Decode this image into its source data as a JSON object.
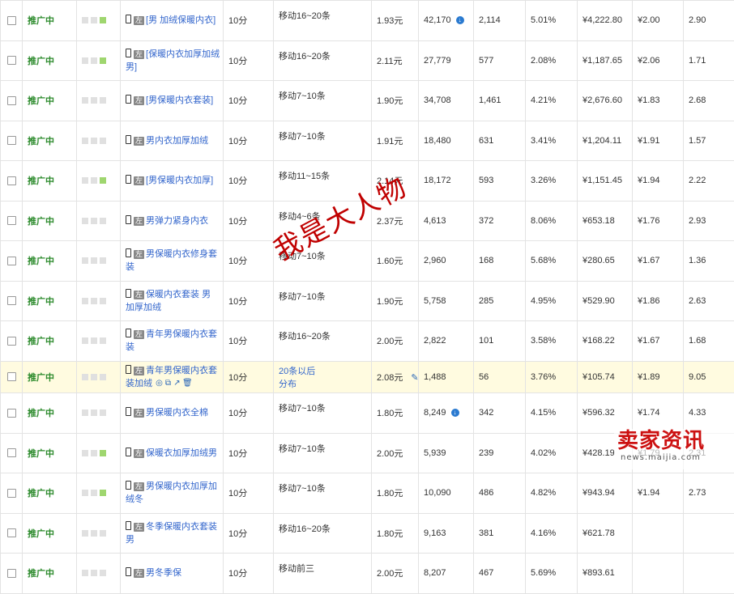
{
  "rows": [
    {
      "status": "推广中",
      "bars": [
        0,
        0,
        1
      ],
      "tag": "左",
      "keyword": "[男 加绒保暖内衣]",
      "actions": false,
      "bid": "10分",
      "match": "移动16~20条",
      "match_link": false,
      "price": "1.93元",
      "pencil": false,
      "impressions": "42,170",
      "imp_icon": true,
      "clicks": "2,114",
      "ctr": "5.01%",
      "cost": "¥4,222.80",
      "cpc": "¥2.00",
      "rank": "2.90",
      "hl": false
    },
    {
      "status": "推广中",
      "bars": [
        0,
        0,
        1
      ],
      "tag": "左",
      "keyword": "[保暖内衣加厚加绒 男]",
      "actions": false,
      "bid": "10分",
      "match": "移动16~20条",
      "match_link": false,
      "price": "2.11元",
      "pencil": false,
      "impressions": "27,779",
      "imp_icon": false,
      "clicks": "577",
      "ctr": "2.08%",
      "cost": "¥1,187.65",
      "cpc": "¥2.06",
      "rank": "1.71",
      "hl": false
    },
    {
      "status": "推广中",
      "bars": [
        0,
        0,
        0
      ],
      "tag": "左",
      "keyword": "[男保暖内衣套装]",
      "actions": false,
      "bid": "10分",
      "match": "移动7~10条",
      "match_link": false,
      "price": "1.90元",
      "pencil": false,
      "impressions": "34,708",
      "imp_icon": false,
      "clicks": "1,461",
      "ctr": "4.21%",
      "cost": "¥2,676.60",
      "cpc": "¥1.83",
      "rank": "2.68",
      "hl": false
    },
    {
      "status": "推广中",
      "bars": [
        0,
        0,
        0
      ],
      "tag": "左",
      "keyword": "男内衣加厚加绒",
      "actions": false,
      "bid": "10分",
      "match": "移动7~10条",
      "match_link": false,
      "price": "1.91元",
      "pencil": false,
      "impressions": "18,480",
      "imp_icon": false,
      "clicks": "631",
      "ctr": "3.41%",
      "cost": "¥1,204.11",
      "cpc": "¥1.91",
      "rank": "1.57",
      "hl": false
    },
    {
      "status": "推广中",
      "bars": [
        0,
        0,
        1
      ],
      "tag": "左",
      "keyword": "[男保暖内衣加厚]",
      "actions": false,
      "bid": "10分",
      "match": "移动11~15条",
      "match_link": false,
      "price": "2.14元",
      "pencil": false,
      "impressions": "18,172",
      "imp_icon": false,
      "clicks": "593",
      "ctr": "3.26%",
      "cost": "¥1,151.45",
      "cpc": "¥1.94",
      "rank": "2.22",
      "hl": false
    },
    {
      "status": "推广中",
      "bars": [
        0,
        0,
        0
      ],
      "tag": "左",
      "keyword": "男弹力紧身内衣",
      "actions": false,
      "bid": "10分",
      "match": "移动4~6条",
      "match_link": false,
      "price": "2.37元",
      "pencil": false,
      "impressions": "4,613",
      "imp_icon": false,
      "clicks": "372",
      "ctr": "8.06%",
      "cost": "¥653.18",
      "cpc": "¥1.76",
      "rank": "2.93",
      "hl": false
    },
    {
      "status": "推广中",
      "bars": [
        0,
        0,
        0
      ],
      "tag": "左",
      "keyword": "男保暖内衣修身套装",
      "actions": false,
      "bid": "10分",
      "match": "移动7~10条",
      "match_link": false,
      "price": "1.60元",
      "pencil": false,
      "impressions": "2,960",
      "imp_icon": false,
      "clicks": "168",
      "ctr": "5.68%",
      "cost": "¥280.65",
      "cpc": "¥1.67",
      "rank": "1.36",
      "hl": false
    },
    {
      "status": "推广中",
      "bars": [
        0,
        0,
        0
      ],
      "tag": "左",
      "keyword": "保暖内衣套装 男 加厚加绒",
      "actions": false,
      "bid": "10分",
      "match": "移动7~10条",
      "match_link": false,
      "price": "1.90元",
      "pencil": false,
      "impressions": "5,758",
      "imp_icon": false,
      "clicks": "285",
      "ctr": "4.95%",
      "cost": "¥529.90",
      "cpc": "¥1.86",
      "rank": "2.63",
      "hl": false
    },
    {
      "status": "推广中",
      "bars": [
        0,
        0,
        0
      ],
      "tag": "左",
      "keyword": "青年男保暖内衣套装",
      "actions": false,
      "bid": "10分",
      "match": "移动16~20条",
      "match_link": false,
      "price": "2.00元",
      "pencil": false,
      "impressions": "2,822",
      "imp_icon": false,
      "clicks": "101",
      "ctr": "3.58%",
      "cost": "¥168.22",
      "cpc": "¥1.67",
      "rank": "1.68",
      "hl": false
    },
    {
      "status": "推广中",
      "bars": [
        0,
        0,
        0
      ],
      "tag": "左",
      "keyword": "青年男保暖内衣套装加绒",
      "actions": true,
      "bid": "10分",
      "match": "20条以后",
      "match2": "分布",
      "match_link": true,
      "price": "2.08元",
      "pencil": true,
      "impressions": "1,488",
      "imp_icon": false,
      "clicks": "56",
      "ctr": "3.76%",
      "cost": "¥105.74",
      "cpc": "¥1.89",
      "rank": "9.05",
      "hl": true
    },
    {
      "status": "推广中",
      "bars": [
        0,
        0,
        0
      ],
      "tag": "左",
      "keyword": "男保暖内衣全棉",
      "actions": false,
      "bid": "10分",
      "match": "移动7~10条",
      "match_link": false,
      "price": "1.80元",
      "pencil": false,
      "impressions": "8,249",
      "imp_icon": true,
      "clicks": "342",
      "ctr": "4.15%",
      "cost": "¥596.32",
      "cpc": "¥1.74",
      "rank": "4.33",
      "hl": false
    },
    {
      "status": "推广中",
      "bars": [
        0,
        0,
        1
      ],
      "tag": "左",
      "keyword": "保暖衣加厚加绒男",
      "actions": false,
      "bid": "10分",
      "match": "移动7~10条",
      "match_link": false,
      "price": "2.00元",
      "pencil": false,
      "impressions": "5,939",
      "imp_icon": false,
      "clicks": "239",
      "ctr": "4.02%",
      "cost": "¥428.19",
      "cpc": "¥1.79",
      "rank": "2.31",
      "hl": false
    },
    {
      "status": "推广中",
      "bars": [
        0,
        0,
        1
      ],
      "tag": "左",
      "keyword": "男保暖内衣加厚加绒冬",
      "actions": false,
      "bid": "10分",
      "match": "移动7~10条",
      "match_link": false,
      "price": "1.80元",
      "pencil": false,
      "impressions": "10,090",
      "imp_icon": false,
      "clicks": "486",
      "ctr": "4.82%",
      "cost": "¥943.94",
      "cpc": "¥1.94",
      "rank": "2.73",
      "hl": false
    },
    {
      "status": "推广中",
      "bars": [
        0,
        0,
        0
      ],
      "tag": "左",
      "keyword": "冬季保暖内衣套装男",
      "actions": false,
      "bid": "10分",
      "match": "移动16~20条",
      "match_link": false,
      "price": "1.80元",
      "pencil": false,
      "impressions": "9,163",
      "imp_icon": false,
      "clicks": "381",
      "ctr": "4.16%",
      "cost": "¥621.78",
      "cpc": "",
      "rank": "",
      "hl": false
    },
    {
      "status": "推广中",
      "bars": [
        0,
        0,
        0
      ],
      "tag": "左",
      "keyword": "男冬季保",
      "actions": false,
      "bid": "10分",
      "match": "移动前三",
      "match_link": false,
      "price": "2.00元",
      "pencil": false,
      "impressions": "8,207",
      "imp_icon": false,
      "clicks": "467",
      "ctr": "5.69%",
      "cost": "¥893.61",
      "cpc": "",
      "rank": "",
      "hl": false
    }
  ],
  "watermark": "我是大人物",
  "logo": {
    "cn": "卖家资讯",
    "url": "news.maijia.com"
  },
  "colors": {
    "status": "#2b8a2b",
    "link": "#3366cc",
    "highlight": "#fffbe0",
    "watermark": "#c00000",
    "logo": "#cc1111"
  }
}
